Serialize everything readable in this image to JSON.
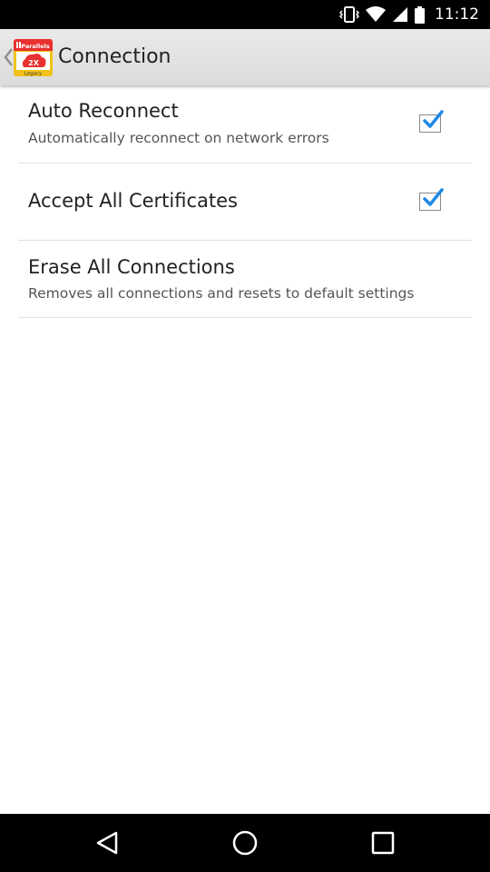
{
  "status_bar": {
    "time": "11:12",
    "icons": [
      "vibrate-icon",
      "wifi-icon",
      "signal-icon",
      "battery-icon"
    ]
  },
  "action_bar": {
    "title": "Connection",
    "app_icon": {
      "name": "parallels-2x-legacy-icon",
      "brand_text": "Parallels",
      "badge_text": "2X",
      "footer_text": "Legacy"
    }
  },
  "settings": [
    {
      "title": "Auto Reconnect",
      "summary": "Automatically reconnect on network errors",
      "checked": true
    },
    {
      "title": "Accept All Certificates",
      "summary": "",
      "checked": true
    },
    {
      "title": "Erase All Connections",
      "summary": "Removes all connections and resets to default settings",
      "checked": null
    }
  ],
  "nav_bar": {
    "buttons": [
      "back-icon",
      "home-icon",
      "recents-icon"
    ]
  },
  "colors": {
    "action_bar": "#e2e2e2",
    "check_accent": "#1e88e5",
    "icon_red": "#e8312f",
    "icon_yellow": "#f2c21b"
  }
}
